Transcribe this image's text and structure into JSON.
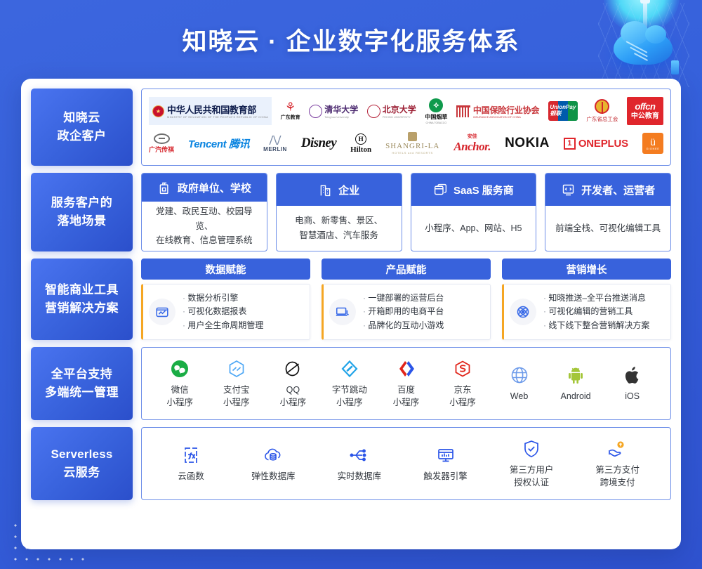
{
  "header": {
    "title": "知晓云 · 企业数字化服务体系"
  },
  "rows": {
    "clients": {
      "label_line1": "知晓云",
      "label_line2": "政企客户",
      "logos_line1": [
        {
          "name": "中华人民共和国教育部",
          "sub": "MINISTRY OF EDUCATION OF THE PEOPLE'S REPUBLIC OF CHINA"
        },
        {
          "name": "广东教育"
        },
        {
          "name": "清华大学",
          "sub": "Tsinghua University"
        },
        {
          "name": "北京大学",
          "sub": "PEKING UNIVERSITY"
        },
        {
          "name": "中国烟草",
          "sub": "CHINA TOBACCO"
        },
        {
          "name": "中国保险行业协会",
          "sub": "INSURANCE ASSOCIATION OF CHINA"
        },
        {
          "name": "UnionPay 银联"
        },
        {
          "name": "广东省总工会"
        },
        {
          "name": "offcn 中公教育"
        }
      ],
      "logos_line2": [
        {
          "name": "广汽传祺"
        },
        {
          "name": "Tencent 腾讯"
        },
        {
          "name": "MERLIN"
        },
        {
          "name": "Disney"
        },
        {
          "name": "Hilton"
        },
        {
          "name": "SHANGRI-LA",
          "sub": "HOTELS and RESORTS"
        },
        {
          "name": "Anchor 安佳"
        },
        {
          "name": "NOKIA"
        },
        {
          "name": "ONEPLUS"
        },
        {
          "name": "GIONEE"
        }
      ]
    },
    "scenes": {
      "label_line1": "服务客户的",
      "label_line2": "落地场景",
      "cards": [
        {
          "icon": "government-building-icon",
          "title": "政府单位、学校",
          "desc_line1": "党建、政民互动、校园导览、",
          "desc_line2": "在线教育、信息管理系统"
        },
        {
          "icon": "office-building-icon",
          "title": "企业",
          "desc_line1": "电商、新零售、景区、",
          "desc_line2": "智慧酒店、汽车服务"
        },
        {
          "icon": "stacked-windows-icon",
          "title": "SaaS 服务商",
          "desc_line1": "小程序、App、网站、H5",
          "desc_line2": ""
        },
        {
          "icon": "code-brackets-icon",
          "title": "开发者、运营者",
          "desc_line1": "前端全栈、可视化编辑工具",
          "desc_line2": ""
        }
      ]
    },
    "tools": {
      "label_line1": "智能商业工具",
      "label_line2": "营销解决方案",
      "cards": [
        {
          "icon": "chart-analytics-icon",
          "title": "数据赋能",
          "items": [
            "数据分析引擎",
            "可视化数据报表",
            "用户全生命周期管理"
          ]
        },
        {
          "icon": "laptop-icon",
          "title": "产品赋能",
          "items": [
            "一键部署的运营后台",
            "开箱即用的电商平台",
            "品牌化的互动小游戏"
          ]
        },
        {
          "icon": "atom-push-icon",
          "title": "营销增长",
          "items": [
            "知晓推送–全平台推送消息",
            "可视化编辑的营销工具",
            "线下线下整合营销解决方案"
          ]
        }
      ]
    },
    "platform": {
      "label_line1": "全平台支持",
      "label_line2": "多端统一管理",
      "items": [
        {
          "icon": "wechat-icon",
          "color": "#1AAD45",
          "cap_line1": "微信",
          "cap_line2": "小程序"
        },
        {
          "icon": "alipay-icon",
          "color": "#4FA8F5",
          "cap_line1": "支付宝",
          "cap_line2": "小程序"
        },
        {
          "icon": "qq-icon",
          "color": "#111111",
          "cap_line1": "QQ",
          "cap_line2": "小程序"
        },
        {
          "icon": "bytedance-icon",
          "color": "#22A4E8",
          "cap_line1": "字节跳动",
          "cap_line2": "小程序"
        },
        {
          "icon": "baidu-icon",
          "color": "#2B55E8",
          "cap_line1": "百度",
          "cap_line2": "小程序"
        },
        {
          "icon": "jd-icon",
          "color": "#E1251B",
          "cap_line1": "京东",
          "cap_line2": "小程序"
        },
        {
          "icon": "globe-web-icon",
          "color": "#6D9BEA",
          "cap_line1": "Web",
          "cap_line2": ""
        },
        {
          "icon": "android-icon",
          "color": "#A4C639",
          "cap_line1": "Android",
          "cap_line2": ""
        },
        {
          "icon": "apple-icon",
          "color": "#333333",
          "cap_line1": "iOS",
          "cap_line2": ""
        }
      ]
    },
    "serverless": {
      "label_line1": "Serverless",
      "label_line2": "云服务",
      "items": [
        {
          "icon": "function-fx-icon",
          "cap_line1": "云函数",
          "cap_line2": ""
        },
        {
          "icon": "cloud-database-icon",
          "cap_line1": "弹性数据库",
          "cap_line2": ""
        },
        {
          "icon": "realtime-nodes-icon",
          "cap_line1": "实时数据库",
          "cap_line2": ""
        },
        {
          "icon": "monitor-trigger-icon",
          "cap_line1": "触发器引擎",
          "cap_line2": ""
        },
        {
          "icon": "shield-check-icon",
          "cap_line1": "第三方用户",
          "cap_line2": "授权认证"
        },
        {
          "icon": "hand-coin-icon",
          "cap_line1": "第三方支付",
          "cap_line2": "跨境支付"
        }
      ]
    }
  },
  "colors": {
    "brand_blue": "#3862DC",
    "deep_blue": "#2B4FCB",
    "accent_orange": "#F5A623",
    "card_border": "#6E8FE8"
  }
}
